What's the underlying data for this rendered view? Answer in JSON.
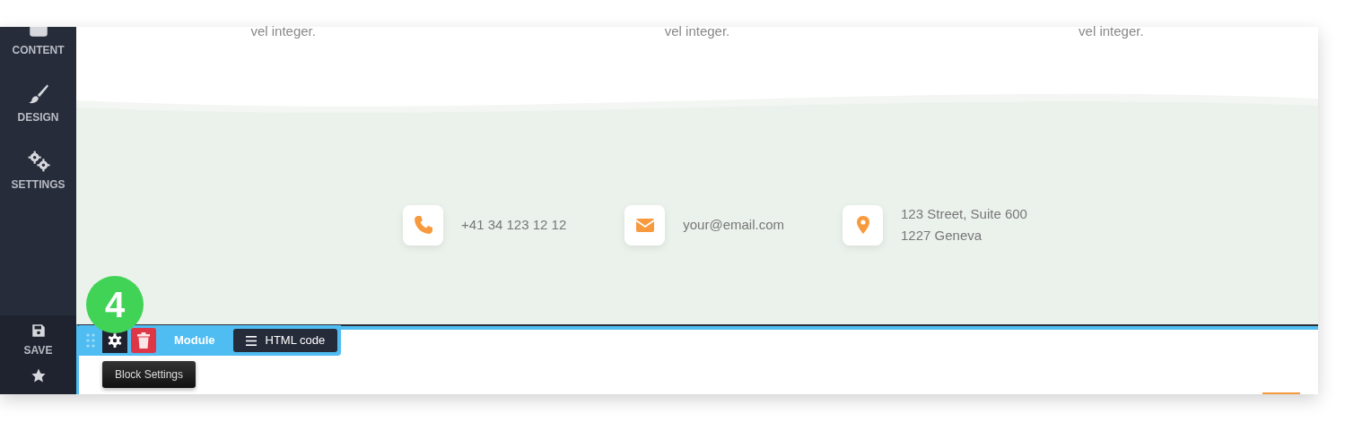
{
  "sidebar": {
    "items": [
      {
        "kind": "content",
        "label": "CONTENT"
      },
      {
        "kind": "design",
        "label": "DESIGN"
      },
      {
        "kind": "settings",
        "label": "SETTINGS"
      }
    ],
    "bottom_items": [
      {
        "kind": "save",
        "label": "SAVE"
      },
      {
        "kind": "star"
      }
    ]
  },
  "features": [
    "vel integer.",
    "vel integer.",
    "vel integer."
  ],
  "contacts": [
    {
      "kind": "phone",
      "lines": [
        "+41 34 123 12 12"
      ]
    },
    {
      "kind": "email",
      "lines": [
        "your@email.com"
      ]
    },
    {
      "kind": "location",
      "lines": [
        "123 Street, Suite 600",
        "1227 Geneva"
      ]
    }
  ],
  "toolbar": {
    "label": "Module",
    "html_button": "HTML code",
    "tooltip": "Block Settings"
  },
  "step_badge": "4"
}
